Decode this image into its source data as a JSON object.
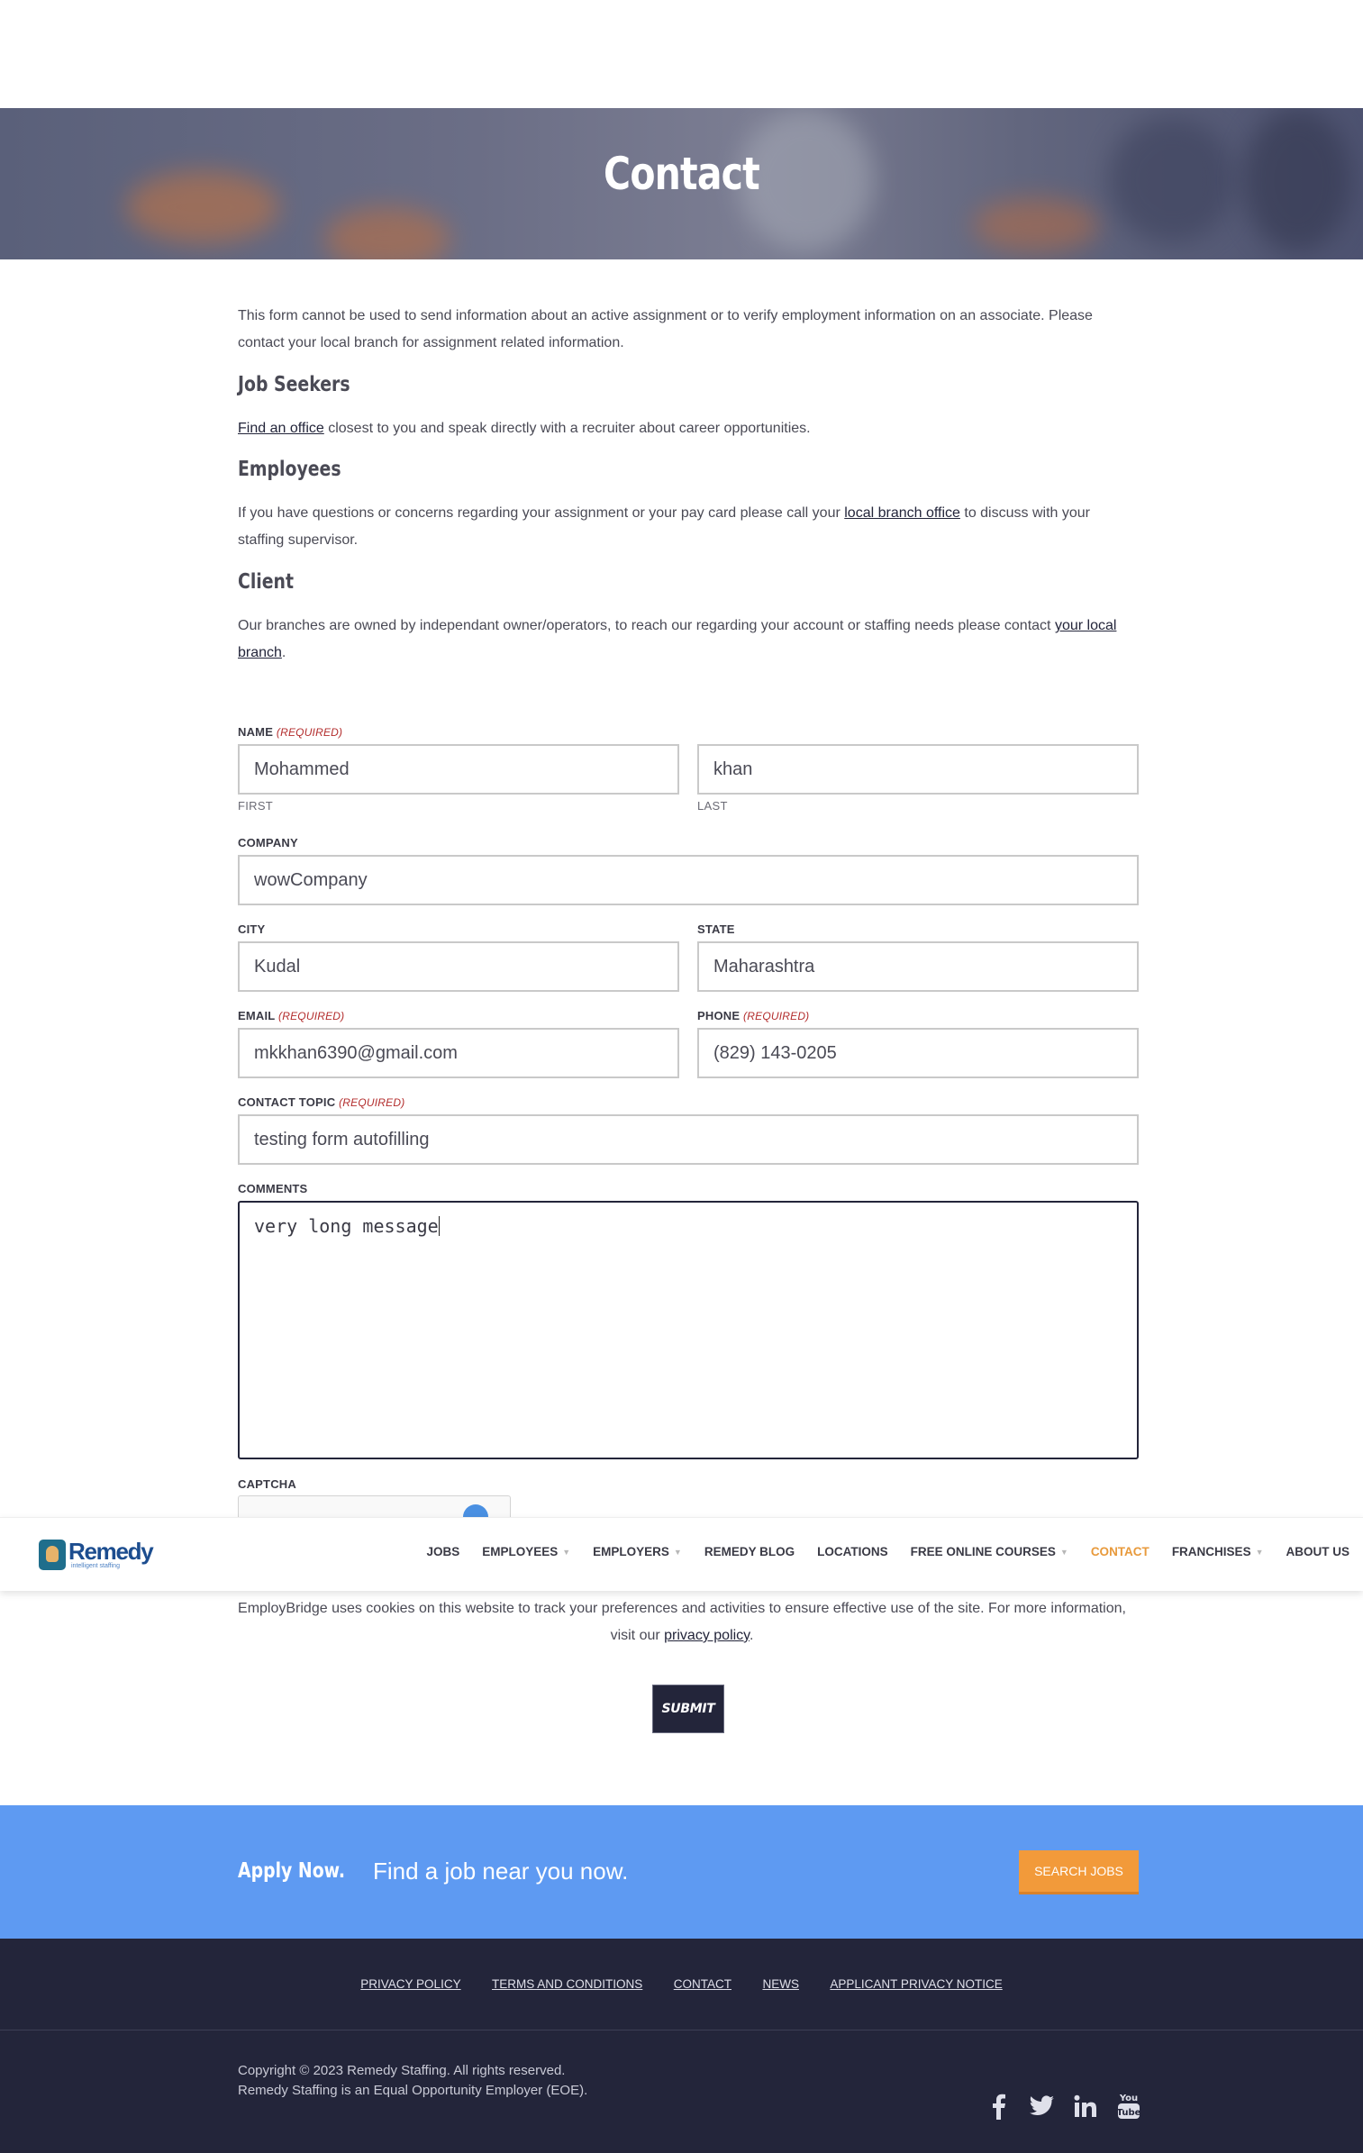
{
  "hero": {
    "title": "Contact"
  },
  "intro": {
    "notice": "This form cannot be used to send information about an active assignment or to verify employment information on an associate. Please contact your local branch for assignment related information.",
    "job_seekers": {
      "heading": "Job Seekers",
      "link": "Find an office",
      "text": " closest to you and speak directly with a recruiter about career opportunities."
    },
    "employees": {
      "heading": "Employees",
      "text_before": "If you have questions or concerns regarding your assignment or your pay card please call your ",
      "link": "local branch office",
      "text_after": " to discuss with your staffing supervisor."
    },
    "client": {
      "heading": "Client",
      "text_before": "Our branches are owned by independant owner/operators, to reach our regarding your account or staffing needs please contact ",
      "link": "your local branch",
      "text_after": "."
    }
  },
  "form": {
    "required_tag": "(REQUIRED)",
    "name": {
      "label": "NAME",
      "first": "Mohammed",
      "last": "khan",
      "first_sub": "FIRST",
      "last_sub": "LAST"
    },
    "company": {
      "label": "COMPANY",
      "value": "wowCompany"
    },
    "city": {
      "label": "CITY",
      "value": "Kudal"
    },
    "state": {
      "label": "STATE",
      "value": "Maharashtra"
    },
    "email": {
      "label": "EMAIL",
      "value": "mkkhan6390@gmail.com"
    },
    "phone": {
      "label": "PHONE",
      "value": "(829) 143-0205"
    },
    "topic": {
      "label": "CONTACT TOPIC",
      "value": "testing form autofilling"
    },
    "comments": {
      "label": "COMMENTS",
      "value": "very long message"
    },
    "captcha": {
      "label": "CAPTCHA"
    },
    "submit_label": "SUBMIT"
  },
  "navbar": {
    "logo_word": "Remedy",
    "logo_tag": "intelligent staffing",
    "items": [
      {
        "label": "JOBS",
        "dropdown": false,
        "active": false
      },
      {
        "label": "EMPLOYEES",
        "dropdown": true,
        "active": false
      },
      {
        "label": "EMPLOYERS",
        "dropdown": true,
        "active": false
      },
      {
        "label": "REMEDY BLOG",
        "dropdown": false,
        "active": false
      },
      {
        "label": "LOCATIONS",
        "dropdown": false,
        "active": false
      },
      {
        "label": "FREE ONLINE COURSES",
        "dropdown": true,
        "active": false
      },
      {
        "label": "CONTACT",
        "dropdown": false,
        "active": true
      },
      {
        "label": "FRANCHISES",
        "dropdown": true,
        "active": false
      },
      {
        "label": "ABOUT US",
        "dropdown": false,
        "active": false
      }
    ]
  },
  "cookie": {
    "text": "EmployBridge uses cookies on this website to track your preferences and activities to ensure effective use of the site. For more information, visit our ",
    "link": "privacy policy",
    "end": "."
  },
  "apply": {
    "title": "Apply Now.",
    "subtitle": "Find a job near you now.",
    "button": "SEARCH JOBS"
  },
  "footer": {
    "links": [
      "PRIVACY POLICY",
      "TERMS AND CONDITIONS",
      "CONTACT",
      "NEWS",
      "APPLICANT PRIVACY NOTICE"
    ],
    "copyright": "Copyright © 2023 Remedy Staffing. All rights reserved.",
    "eoe": "Remedy Staffing is an Equal Opportunity Employer (EOE).",
    "social": [
      "facebook-icon",
      "twitter-icon",
      "linkedin-icon",
      "youtube-icon"
    ]
  },
  "colors": {
    "accent": "#e89a3c",
    "navy": "#23253a",
    "apply_blue": "#5e9af2",
    "required_red": "#b32d2d"
  }
}
